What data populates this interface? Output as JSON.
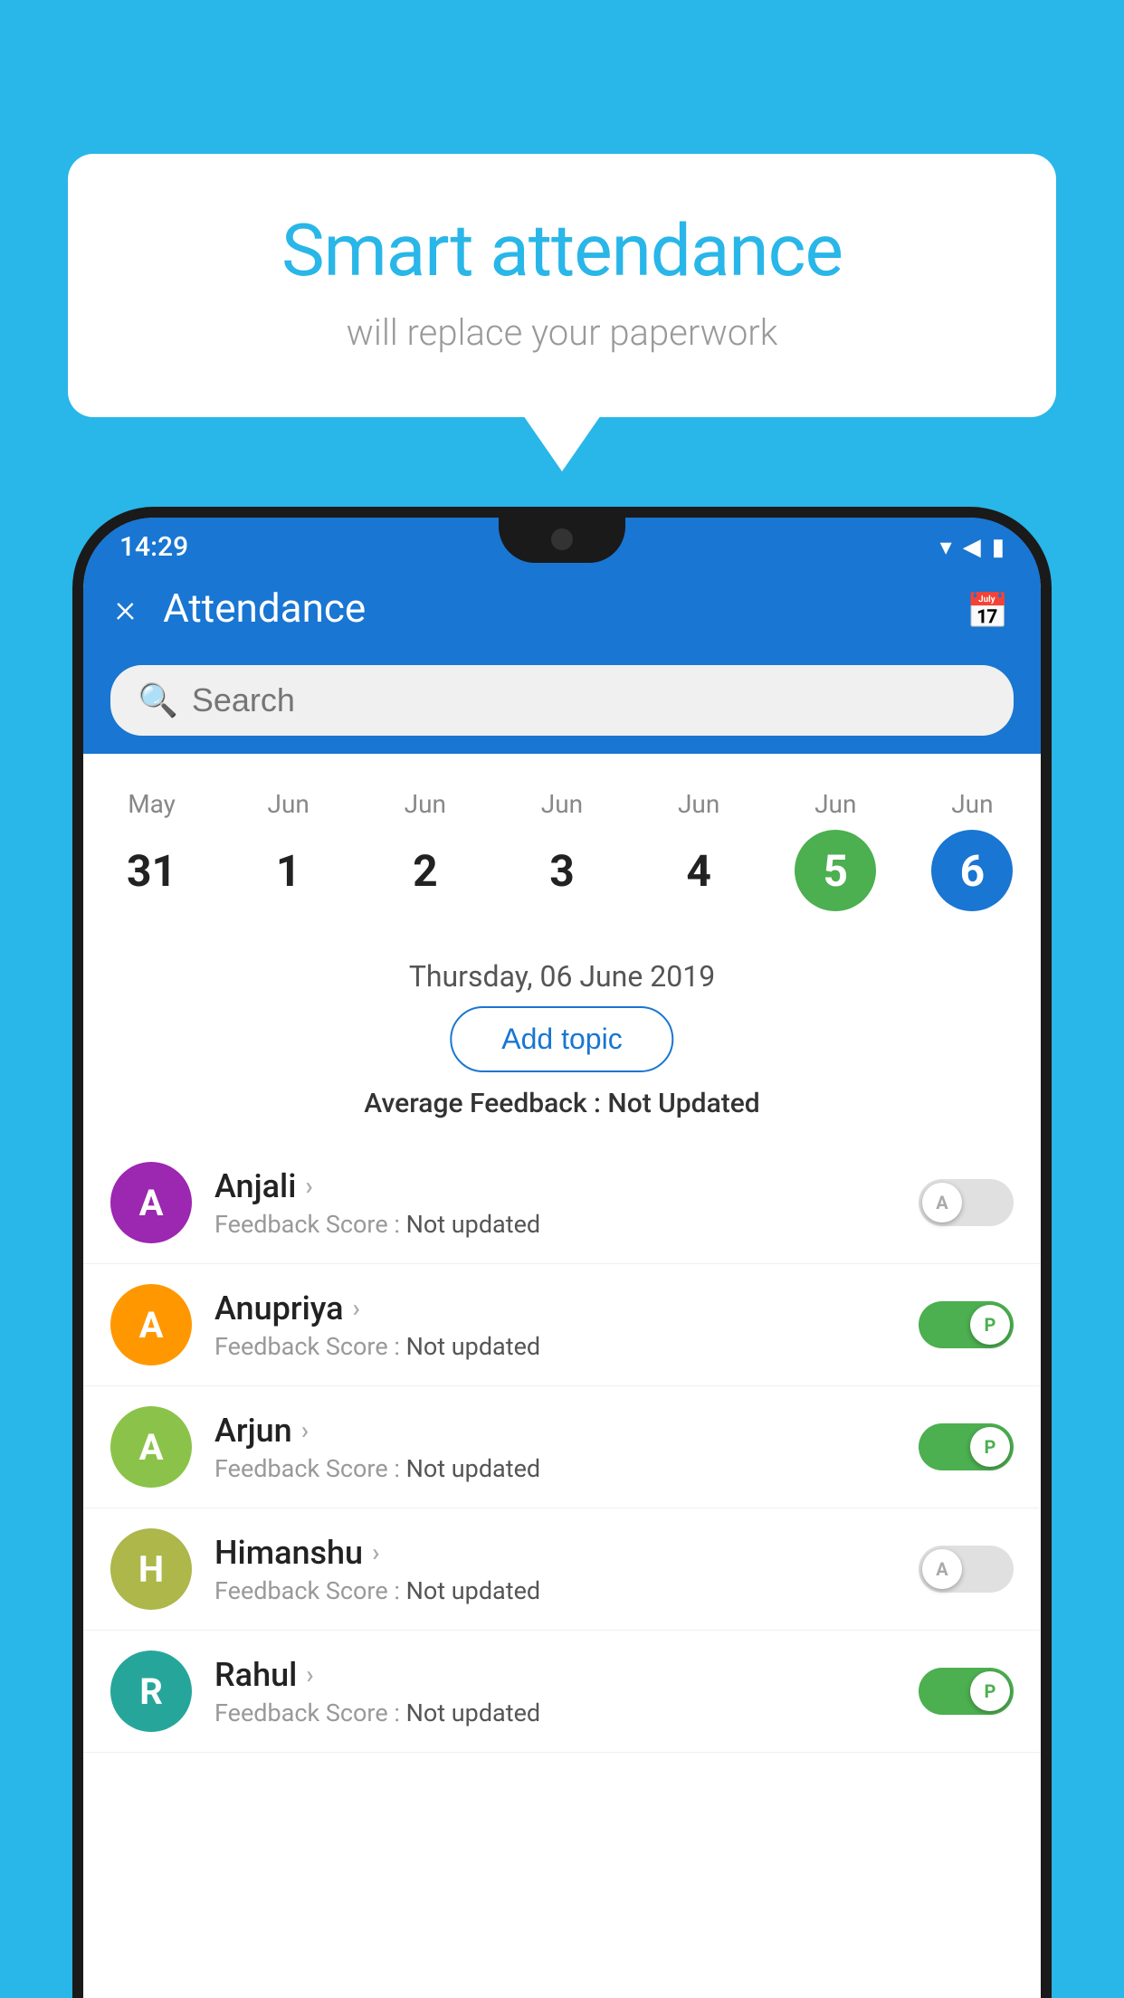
{
  "background": {
    "color": "#29b6e8"
  },
  "speech_bubble": {
    "title": "Smart attendance",
    "subtitle": "will replace your paperwork"
  },
  "status_bar": {
    "time": "14:29",
    "icons": [
      "wifi",
      "signal",
      "battery"
    ]
  },
  "app_bar": {
    "title": "Attendance",
    "close_label": "×",
    "calendar_label": "📅"
  },
  "search": {
    "placeholder": "Search"
  },
  "calendar": {
    "days": [
      {
        "month": "May",
        "num": "31",
        "state": "normal"
      },
      {
        "month": "Jun",
        "num": "1",
        "state": "normal"
      },
      {
        "month": "Jun",
        "num": "2",
        "state": "normal"
      },
      {
        "month": "Jun",
        "num": "3",
        "state": "normal"
      },
      {
        "month": "Jun",
        "num": "4",
        "state": "normal"
      },
      {
        "month": "Jun",
        "num": "5",
        "state": "today"
      },
      {
        "month": "Jun",
        "num": "6",
        "state": "selected"
      }
    ],
    "selected_date": "Thursday, 06 June 2019"
  },
  "add_topic": {
    "label": "Add topic"
  },
  "feedback_summary": {
    "label": "Average Feedback : ",
    "value": "Not Updated"
  },
  "students": [
    {
      "name": "Anjali",
      "initial": "A",
      "avatar_color": "avatar-purple",
      "feedback_label": "Feedback Score : ",
      "feedback_value": "Not updated",
      "toggle_state": "off",
      "toggle_label": "A"
    },
    {
      "name": "Anupriya",
      "initial": "A",
      "avatar_color": "avatar-orange",
      "feedback_label": "Feedback Score : ",
      "feedback_value": "Not updated",
      "toggle_state": "on",
      "toggle_label": "P"
    },
    {
      "name": "Arjun",
      "initial": "A",
      "avatar_color": "avatar-green",
      "feedback_label": "Feedback Score : ",
      "feedback_value": "Not updated",
      "toggle_state": "on",
      "toggle_label": "P"
    },
    {
      "name": "Himanshu",
      "initial": "H",
      "avatar_color": "avatar-lime",
      "feedback_label": "Feedback Score : ",
      "feedback_value": "Not updated",
      "toggle_state": "off",
      "toggle_label": "A"
    },
    {
      "name": "Rahul",
      "initial": "R",
      "avatar_color": "avatar-teal",
      "feedback_label": "Feedback Score : ",
      "feedback_value": "Not updated",
      "toggle_state": "on",
      "toggle_label": "P"
    }
  ]
}
